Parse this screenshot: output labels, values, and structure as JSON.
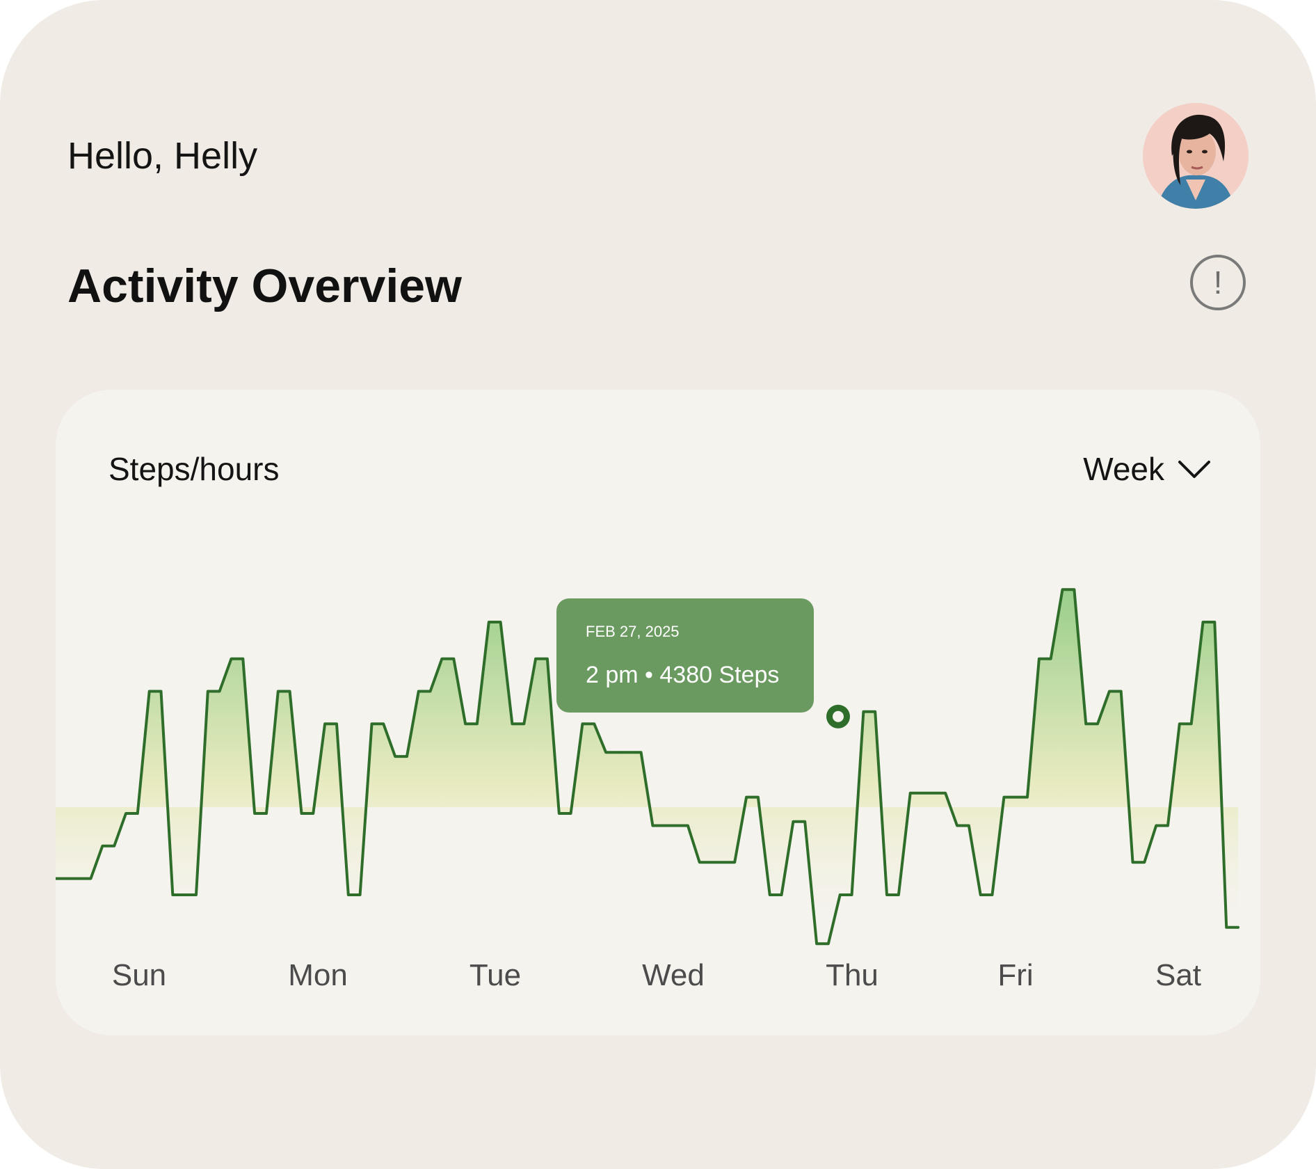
{
  "header": {
    "greeting": "Hello, Helly",
    "title": "Activity Overview",
    "info_icon": "!",
    "avatar": "user-avatar"
  },
  "card": {
    "title": "Steps/hours",
    "period": "Week",
    "tooltip": {
      "date": "FEB 27, 2025",
      "text": "2 pm • 4380 Steps"
    }
  },
  "chart_data": {
    "type": "line",
    "step": true,
    "title": "Steps/hours",
    "xlabel": "",
    "ylabel": "",
    "categories": [
      "Sun",
      "Mon",
      "Tue",
      "Wed",
      "Thu",
      "Fri",
      "Sat"
    ],
    "series": [
      {
        "values": [
          400,
          400,
          400,
          400,
          1200,
          1200,
          2000,
          2000,
          5000,
          5000,
          0,
          0,
          0,
          5000,
          5000,
          5800,
          5800,
          2000,
          2000,
          5000,
          5000,
          2000,
          2000,
          4200,
          4200,
          0,
          0,
          4200,
          4200,
          3400,
          3400,
          5000,
          5000,
          5800,
          5800,
          4200,
          4200,
          6700,
          6700,
          4200,
          4200,
          5800,
          5800,
          2000,
          2000,
          4200,
          4200,
          3500,
          3500,
          3500,
          3500,
          1700,
          1700,
          1700,
          1700,
          800,
          800,
          800,
          800,
          2400,
          2400,
          0,
          0,
          1800,
          1800,
          -1200,
          -1200,
          0,
          0,
          4500,
          4500,
          0,
          0,
          2500,
          2500,
          2500,
          2500,
          1700,
          1700,
          0,
          0,
          2400,
          2400,
          2400,
          5800,
          5800,
          7500,
          7500,
          4200,
          4200,
          5000,
          5000,
          800,
          800,
          1700,
          1700,
          4200,
          4200,
          6700,
          6700,
          -800,
          -800
        ]
      }
    ],
    "highlight": {
      "label": "2 pm • 4380 Steps",
      "value": 4380
    },
    "colors": {
      "line": "#2e6e2a",
      "fill_top": "#8fca80",
      "fill_mid": "#e6e9b8",
      "tooltip": "#6a9a5f",
      "background": "#f5f3ee"
    }
  }
}
